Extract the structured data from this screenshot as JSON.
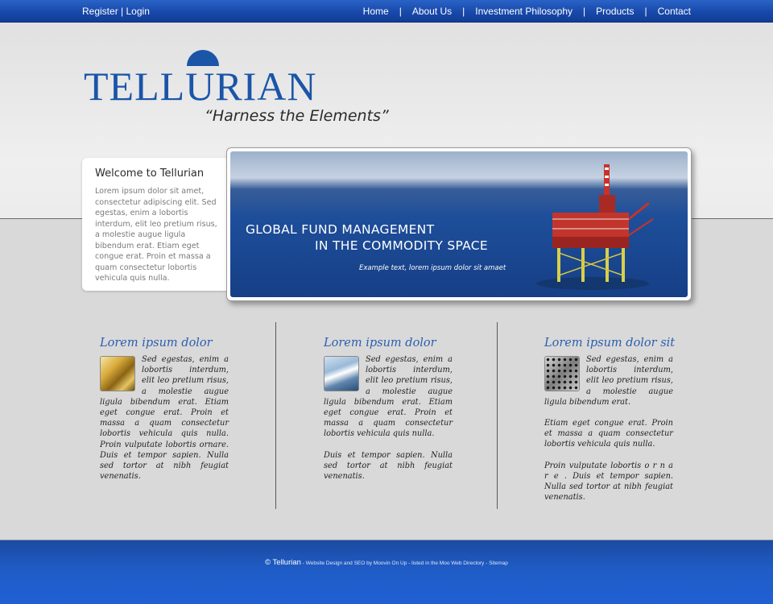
{
  "topbar": {
    "register": "Register",
    "auth_sep": "|",
    "login": "Login",
    "nav": [
      "Home",
      "About Us",
      "Investment Philosophy",
      "Products",
      "Contact"
    ],
    "nav_sep": "|"
  },
  "header": {
    "logo_text": "TELLURIAN",
    "tagline": "“Harness the Elements”"
  },
  "welcome": {
    "title": "Welcome to Tellurian",
    "text": "Lorem ipsum dolor sit amet, consectetur adipiscing elit. Sed egestas, enim a lobortis interdum, elit leo pretium risus, a molestie augue ligula bibendum erat. Etiam eget congue erat. Proin et massa a quam consectetur lobortis vehicula quis nulla."
  },
  "banner": {
    "title_line1": "GLOBAL FUND MANAGEMENT",
    "title_line2": "IN THE COMMODITY SPACE",
    "caption": "Example text, lorem ipsum dolor sit amaet"
  },
  "columns": [
    {
      "title": "Lorem ipsum dolor",
      "icon": "gold-bars-icon",
      "paragraphs": [
        "Sed egestas, enim a lobortis interdum, elit leo pretium risus, a molestie augue ligula bibendum erat. Etiam eget congue erat. Proin et massa a quam consectetur lobortis vehicula quis nulla. Proin vulputate lobortis ornare. Duis et tempor sapien. Nulla sed tortor at nibh feugiat venenatis."
      ]
    },
    {
      "title": "Lorem ipsum dolor",
      "icon": "ship-icon",
      "paragraphs": [
        "Sed egestas, enim a lobortis interdum, elit leo pretium risus, a molestie augue ligula bibendum erat. Etiam eget congue erat. Proin et massa a quam consectetur lobortis vehicula quis nulla.",
        "Duis et tempor sapien. Nulla sed tortor at nibh feugiat venenatis."
      ]
    },
    {
      "title": "Lorem ipsum dolor sit",
      "icon": "metal-mesh-icon",
      "paragraphs": [
        "Sed egestas, enim a lobortis interdum, elit leo pretium risus, a molestie augue ligula bibendum erat.",
        "Etiam eget congue erat. Proin et massa a quam consectetur lobortis vehicula quis nulla.",
        "Proin vulputate lobortis o r n a r e . Duis et tempor sapien. Nulla sed tortor at nibh feugiat venenatis."
      ]
    }
  ],
  "footer": {
    "brand": "© Tellurian",
    "text": " - Website Design and SEO by Moovin On Up - listed in the Moo Web Directory - Sitemap"
  },
  "colors": {
    "brand_blue": "#1a55a8",
    "topbar_blue": "#1747a8",
    "footer_blue": "#1f5cc6",
    "heading_blue": "#2a5eb0"
  }
}
